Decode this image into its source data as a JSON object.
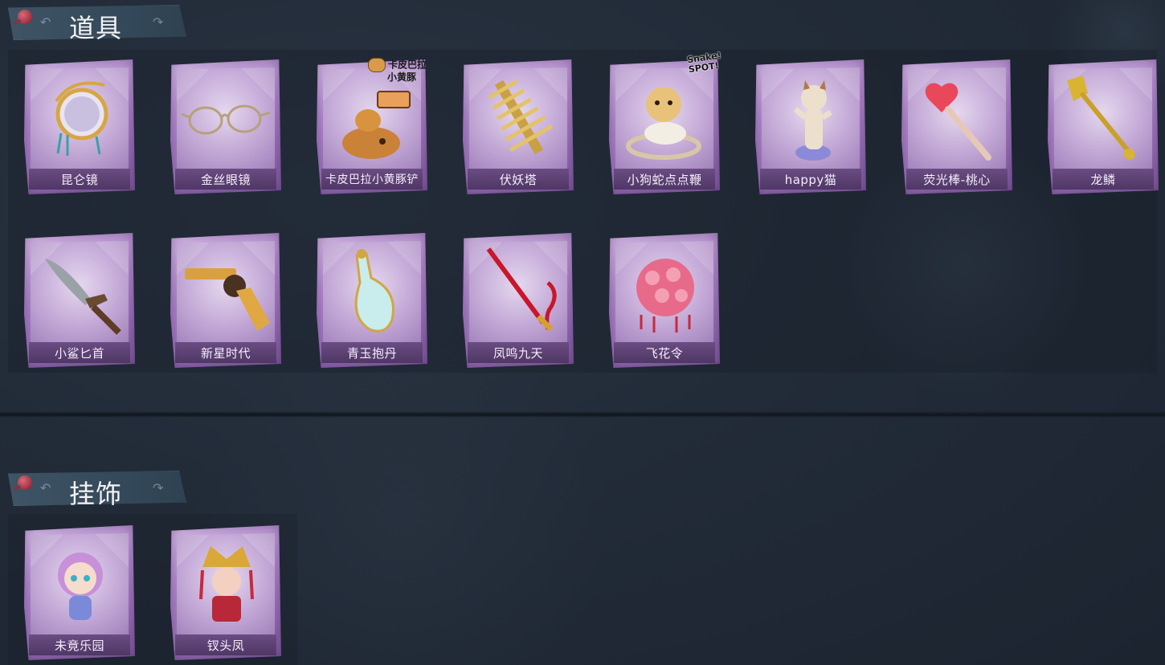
{
  "sections": [
    {
      "title": "道具",
      "items": [
        {
          "label": "昆仑镜",
          "icon": "mirror-icon"
        },
        {
          "label": "金丝眼镜",
          "icon": "glasses-icon"
        },
        {
          "label": "卡皮巴拉小黄豚铲",
          "icon": "capybara-shovel-icon",
          "badge_line1": "卡皮巴拉",
          "badge_line2": "小黄豚"
        },
        {
          "label": "伏妖塔",
          "icon": "pagoda-icon"
        },
        {
          "label": "小狗蛇点点鞭",
          "icon": "snake-whip-icon",
          "badge_line1": "Snake!",
          "badge_line2": "SPOT!"
        },
        {
          "label": "happy猫",
          "icon": "cat-figure-icon"
        },
        {
          "label": "荧光棒-桃心",
          "icon": "heart-wand-icon"
        },
        {
          "label": "龙鳞",
          "icon": "golden-spade-icon"
        },
        {
          "label": "小鲨匕首",
          "icon": "shark-dagger-icon"
        },
        {
          "label": "新星时代",
          "icon": "revolver-icon"
        },
        {
          "label": "青玉抱丹",
          "icon": "jade-vase-icon"
        },
        {
          "label": "凤鸣九天",
          "icon": "red-sword-icon"
        },
        {
          "label": "飞花令",
          "icon": "flower-lantern-icon"
        }
      ]
    },
    {
      "title": "挂饰",
      "items": [
        {
          "label": "未竟乐园",
          "icon": "doll-charm-icon"
        },
        {
          "label": "钗头凤",
          "icon": "phoenix-crown-charm-icon"
        }
      ]
    }
  ],
  "colors": {
    "background": "#222b38",
    "card_purple": "#b58fcf",
    "label_bar": "#5a4070",
    "header_banner": "#3f5464"
  }
}
